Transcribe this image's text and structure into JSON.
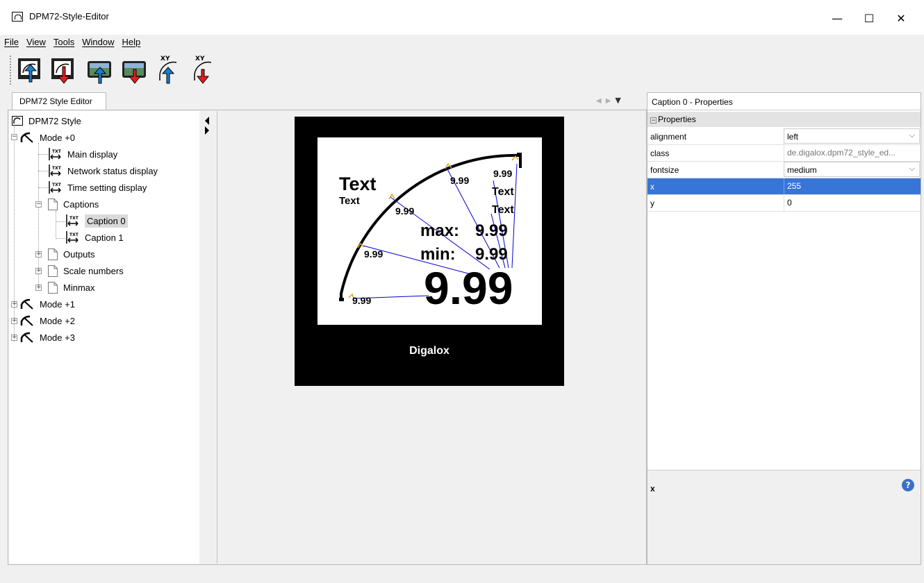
{
  "window": {
    "title": "DPM72-Style-Editor",
    "minimize_glyph": "—",
    "maximize_glyph": "☐",
    "close_glyph": "✕"
  },
  "menu": [
    "File",
    "View",
    "Tools",
    "Window",
    "Help"
  ],
  "toolbar": {
    "buttons": [
      "import-style-icon",
      "export-style-icon",
      "import-background-icon",
      "export-background-icon",
      "import-xy-icon",
      "export-xy-icon"
    ]
  },
  "editor_tab": {
    "label": "DPM72 Style Editor"
  },
  "tree": {
    "root": "DPM72 Style",
    "mode0": "Mode +0",
    "main_display": "Main display",
    "network_status_display": "Network status display",
    "time_setting_display": "Time setting display",
    "captions": "Captions",
    "caption0": "Caption 0",
    "caption1": "Caption 1",
    "outputs": "Outputs",
    "scale_numbers": "Scale numbers",
    "minmax": "Minmax",
    "mode1": "Mode +1",
    "mode2": "Mode +2",
    "mode3": "Mode +3"
  },
  "preview": {
    "text_large": "Text",
    "text_small": "Text",
    "scale_value": "9.99",
    "right_text_1": "Text",
    "right_text_2": "Text",
    "max_label": "max:",
    "min_label": "min:",
    "max_value": "9.99",
    "min_value": "9.99",
    "main_value": "9.99",
    "brand": "Digalox"
  },
  "properties": {
    "title": "Caption 0 - Properties",
    "section": "Properties",
    "rows": [
      {
        "name": "alignment",
        "value": "left"
      },
      {
        "name": "class",
        "value": "de.digalox.dpm72_style_ed..."
      },
      {
        "name": "fontsize",
        "value": "medium"
      },
      {
        "name": "x",
        "value": "255"
      },
      {
        "name": "y",
        "value": "0"
      }
    ],
    "selected": "x",
    "description_name": "x",
    "help": "?"
  },
  "colors": {
    "selection": "#3875d7",
    "guide_line": "#0000cc",
    "anchor": "#e0a020"
  }
}
